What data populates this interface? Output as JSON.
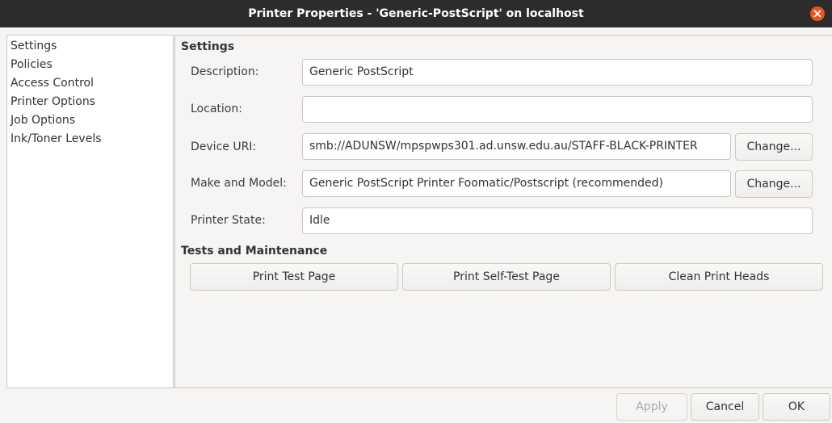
{
  "window": {
    "title": "Printer Properties - 'Generic-PostScript' on localhost"
  },
  "sidebar": {
    "items": [
      {
        "label": "Settings"
      },
      {
        "label": "Policies"
      },
      {
        "label": "Access Control"
      },
      {
        "label": "Printer Options"
      },
      {
        "label": "Job Options"
      },
      {
        "label": "Ink/Toner Levels"
      }
    ]
  },
  "settings": {
    "heading": "Settings",
    "description": {
      "label": "Description:",
      "value": "Generic PostScript"
    },
    "location": {
      "label": "Location:",
      "value": ""
    },
    "device_uri": {
      "label": "Device URI:",
      "value": "smb://ADUNSW/mpspwps301.ad.unsw.edu.au/STAFF-BLACK-PRINTER",
      "change_label": "Change..."
    },
    "make_model": {
      "label": "Make and Model:",
      "value": "Generic PostScript Printer Foomatic/Postscript (recommended)",
      "change_label": "Change..."
    },
    "printer_state": {
      "label": "Printer State:",
      "value": "Idle"
    }
  },
  "maintenance": {
    "heading": "Tests and Maintenance",
    "print_test_page": "Print Test Page",
    "print_self_test_page": "Print Self-Test Page",
    "clean_print_heads": "Clean Print Heads"
  },
  "footer": {
    "apply": "Apply",
    "cancel": "Cancel",
    "ok": "OK"
  },
  "colors": {
    "titlebar": "#2c2c2c",
    "close_button": "#e95420",
    "background": "#f6f5f4",
    "border": "#cdc7c2"
  },
  "icons": {
    "close": "close-icon"
  }
}
